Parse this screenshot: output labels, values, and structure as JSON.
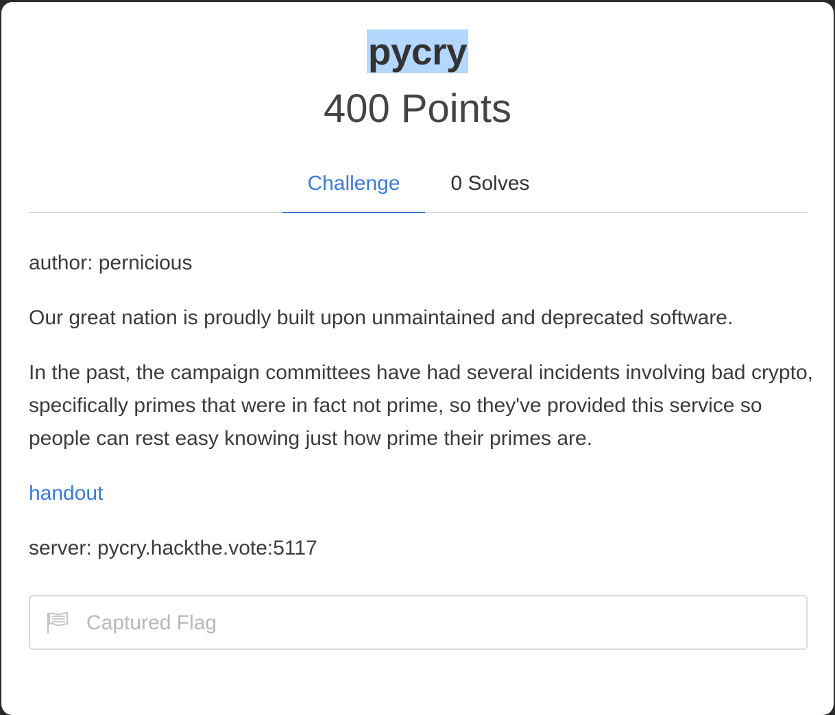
{
  "challenge": {
    "name": "pycry",
    "points": "400 Points"
  },
  "tabs": {
    "challenge_label": "Challenge",
    "solves_label": "0 Solves"
  },
  "content": {
    "author": "author: pernicious",
    "paragraph1": "Our great nation is proudly built upon unmaintained and deprecated software.",
    "paragraph2": "In the past, the campaign committees have had several incidents involving bad crypto, specifically primes that were in fact not prime, so they've provided this service so people can rest easy knowing just how prime their primes are.",
    "handout_link": "handout",
    "server": "server: pycry.hackthe.vote:5117"
  },
  "flag_input": {
    "placeholder": "Captured Flag",
    "value": "",
    "icon": "flag-icon"
  },
  "colors": {
    "accent": "#3a7bd5",
    "selection": "#b4d7fd",
    "text": "#3b3b3b"
  }
}
